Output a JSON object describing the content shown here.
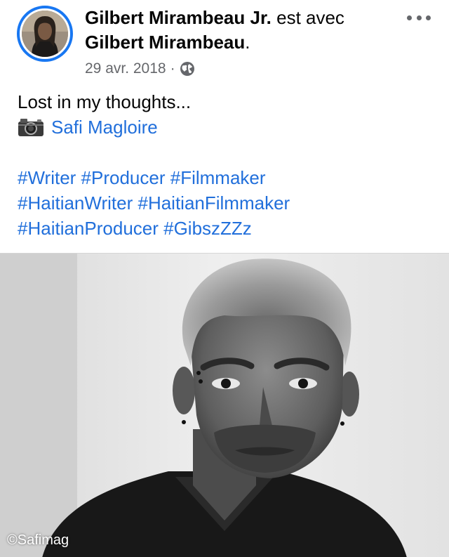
{
  "post": {
    "author": "Gilbert Mirambeau Jr.",
    "with_word": "est avec",
    "tagged_user": "Gilbert Mirambeau",
    "period": ".",
    "date": "29 avr. 2018",
    "separator": "·",
    "privacy_icon": "globe-icon",
    "more_icon": "more-options-icon"
  },
  "body": {
    "line1": "Lost in my thoughts...",
    "camera_icon": "camera-icon",
    "photo_credit": "Safi Magloire",
    "hashtags_line1": [
      "#Writer",
      "#Producer",
      "#Filmmaker"
    ],
    "hashtags_line2": [
      "#HaitianWriter",
      "#HaitianFilmmaker"
    ],
    "hashtags_line3": [
      "#HaitianProducer",
      "#GibszZZz"
    ]
  },
  "photo": {
    "watermark": "©Safimag"
  },
  "colors": {
    "link": "#216fdb",
    "story_ring": "#1877f2",
    "secondary_text": "#65676b"
  }
}
